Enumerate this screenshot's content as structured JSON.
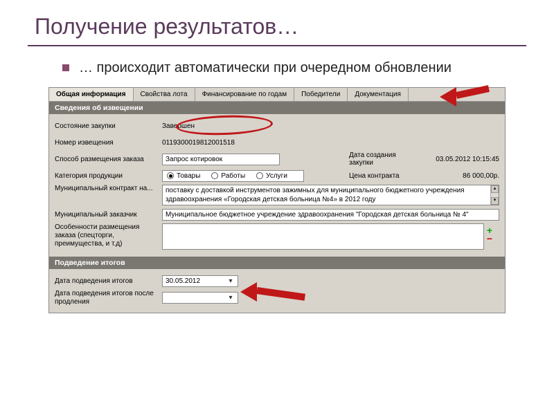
{
  "slide": {
    "title": "Получение результатов…",
    "bullet": "… происходит автоматически при очередном обновлении"
  },
  "tabs": [
    "Общая информация",
    "Свойства лота",
    "Финансирование по годам",
    "Победители",
    "Документация"
  ],
  "section1": {
    "header": "Сведения об извещении",
    "state_label": "Состояние закупки",
    "state_value": "Завершен",
    "number_label": "Номер извещения",
    "number_value": "0119300019812001518",
    "method_label": "Способ размещения заказа",
    "method_value": "Запрос котировок",
    "created_label": "Дата создания закупки",
    "created_value": "03.05.2012 10:15:45",
    "category_label": "Категория продукции",
    "radio_goods": "Товары",
    "radio_works": "Работы",
    "radio_services": "Услуги",
    "price_label": "Цена контракта",
    "price_value": "86 000,00р.",
    "contract_label": "Муниципальный контракт на...",
    "contract_value": "поставку с доставкой инструментов зажимных для муниципального бюджетного учреждения здравоохранения «Городская детская больница №4» в 2012 году",
    "customer_label": "Муниципальный заказчик",
    "customer_value": "Муниципальное бюджетное учреждение здравоохранения \"Городская детская больница № 4\"",
    "features_label": "Особенности размещения заказа (спецторги, преимущества, и т.д)"
  },
  "section2": {
    "header": "Подведение итогов",
    "date_label": "Дата подведения итогов",
    "date_value": "30.05.2012",
    "date2_label": "Дата подведения итогов после продления"
  }
}
